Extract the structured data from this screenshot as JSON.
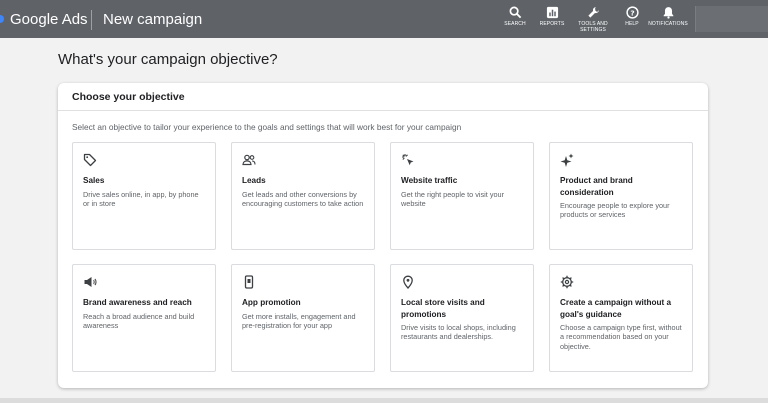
{
  "header": {
    "brand": "Google Ads",
    "page_name": "New campaign",
    "tools": [
      {
        "label": "SEARCH",
        "icon": "search-icon"
      },
      {
        "label": "REPORTS",
        "icon": "reports-icon"
      },
      {
        "label": "TOOLS AND SETTINGS",
        "icon": "wrench-icon"
      },
      {
        "label": "HELP",
        "icon": "help-icon"
      },
      {
        "label": "NOTIFICATIONS",
        "icon": "bell-icon"
      }
    ]
  },
  "main": {
    "heading": "What's your campaign objective?",
    "card_title": "Choose your objective",
    "card_subtitle": "Select an objective to tailor your experience to the goals and settings that will work best for your campaign",
    "objectives": [
      {
        "title": "Sales",
        "description": "Drive sales online, in app, by phone or in store",
        "icon": "tag-icon"
      },
      {
        "title": "Leads",
        "description": "Get leads and other conversions by encouraging customers to take action",
        "icon": "people-icon"
      },
      {
        "title": "Website traffic",
        "description": "Get the right people to visit your website",
        "icon": "cursor-click-icon"
      },
      {
        "title": "Product and brand consideration",
        "description": "Encourage people to explore your products or services",
        "icon": "sparkle-icon"
      },
      {
        "title": "Brand awareness and reach",
        "description": "Reach a broad audience and build awareness",
        "icon": "megaphone-icon"
      },
      {
        "title": "App promotion",
        "description": "Get more installs, engagement and pre-registration for your app",
        "icon": "phone-icon"
      },
      {
        "title": "Local store visits and promotions",
        "description": "Drive visits to local shops, including restaurants and dealerships.",
        "icon": "location-pin-icon"
      },
      {
        "title": "Create a campaign without a goal's guidance",
        "description": "Choose a campaign type first, without a recommendation based on your objective.",
        "icon": "gear-icon"
      }
    ]
  }
}
